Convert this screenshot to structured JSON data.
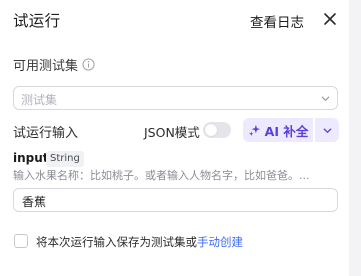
{
  "header": {
    "title": "试运行",
    "view_log": "查看日志"
  },
  "testset": {
    "label": "可用测试集",
    "placeholder": "测试集"
  },
  "run_input": {
    "label": "试运行输入",
    "json_mode_label": "JSON模式",
    "json_mode_on": false,
    "ai_fill_label": "AI 补全"
  },
  "field": {
    "name": "input",
    "type": "String",
    "hint": "输入水果名称：比如桃子。或者输入人物名字，比如爸爸。...",
    "value": "香蕉"
  },
  "save": {
    "checked": false,
    "text": "将本次运行输入保存为测试集或",
    "link": "手动创建"
  },
  "colors": {
    "accent": "#5b3fd6",
    "accent_bg": "#ede9fe",
    "link": "#3b6cf5"
  }
}
